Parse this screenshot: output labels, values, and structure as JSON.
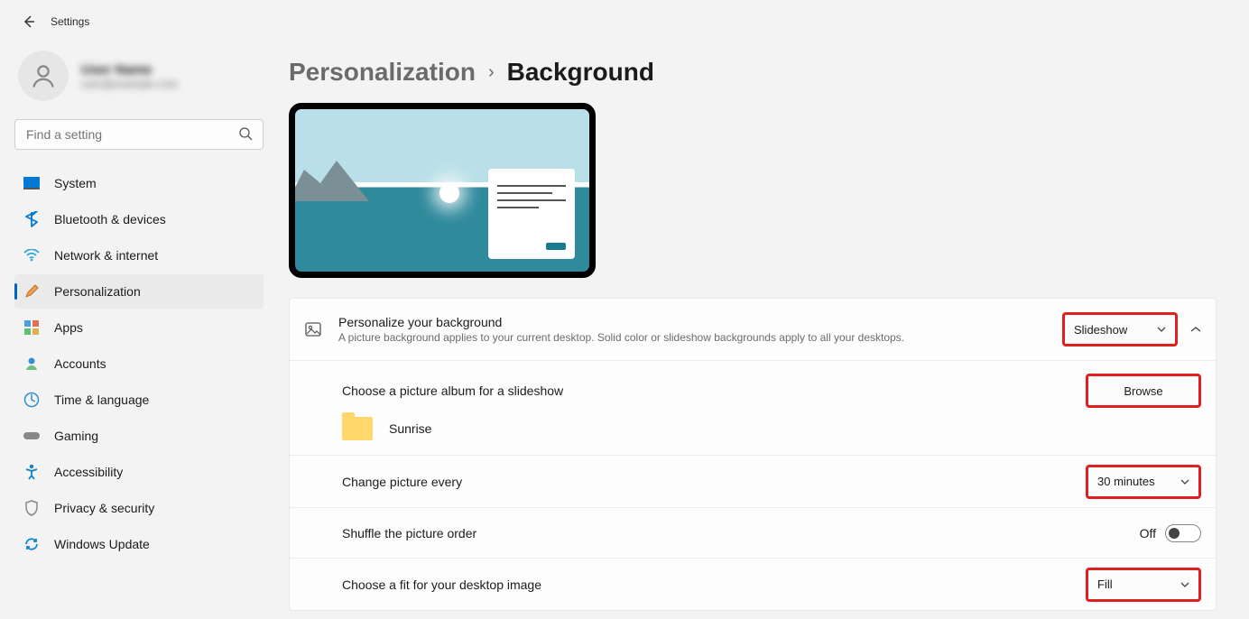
{
  "window": {
    "title": "Settings"
  },
  "user": {
    "name": "User Name",
    "email": "user@example.com"
  },
  "search": {
    "placeholder": "Find a setting"
  },
  "nav": {
    "items": [
      {
        "label": "System"
      },
      {
        "label": "Bluetooth & devices"
      },
      {
        "label": "Network & internet"
      },
      {
        "label": "Personalization"
      },
      {
        "label": "Apps"
      },
      {
        "label": "Accounts"
      },
      {
        "label": "Time & language"
      },
      {
        "label": "Gaming"
      },
      {
        "label": "Accessibility"
      },
      {
        "label": "Privacy & security"
      },
      {
        "label": "Windows Update"
      }
    ]
  },
  "breadcrumb": {
    "parent": "Personalization",
    "current": "Background"
  },
  "rows": {
    "personalize": {
      "title": "Personalize your background",
      "sub": "A picture background applies to your current desktop. Solid color or slideshow backgrounds apply to all your desktops.",
      "value": "Slideshow"
    },
    "album": {
      "title": "Choose a picture album for a slideshow",
      "button": "Browse",
      "folder": "Sunrise"
    },
    "interval": {
      "title": "Change picture every",
      "value": "30 minutes"
    },
    "shuffle": {
      "title": "Shuffle the picture order",
      "state": "Off"
    },
    "fit": {
      "title": "Choose a fit for your desktop image",
      "value": "Fill"
    }
  }
}
